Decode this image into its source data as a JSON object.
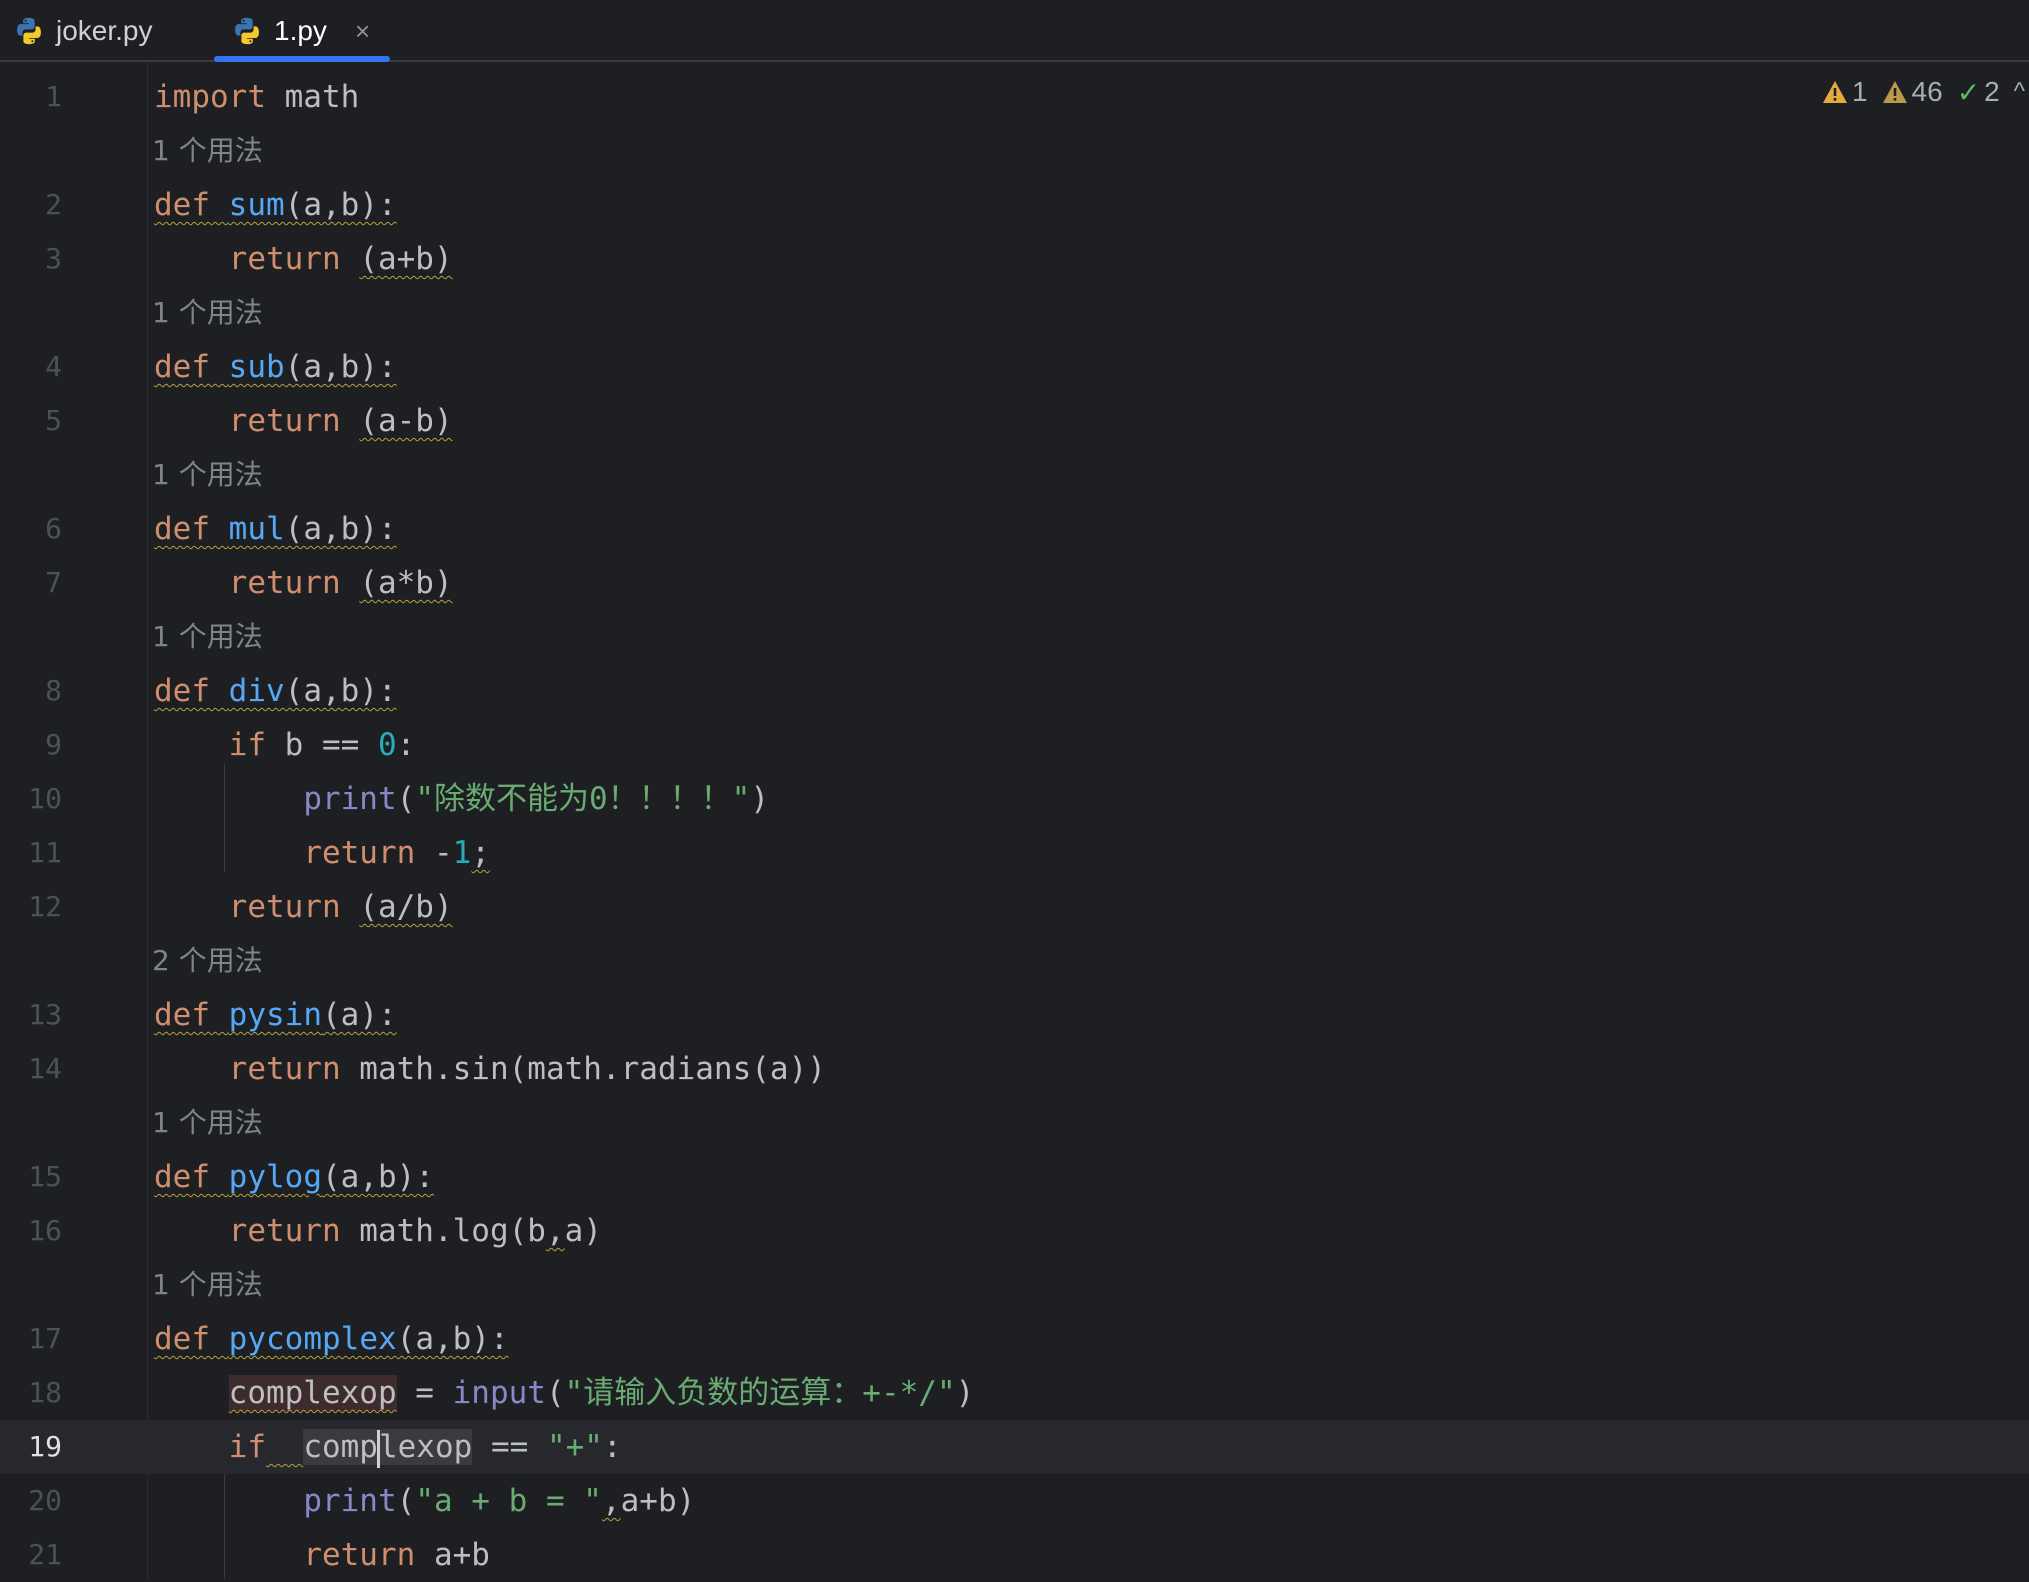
{
  "tabs": [
    {
      "label": "joker.py",
      "icon": "python-file-icon",
      "active": false
    },
    {
      "label": "1.py",
      "icon": "python-file-icon",
      "active": true,
      "close": "×"
    }
  ],
  "colors": {
    "background": "#1e1f22",
    "accent": "#3574f0",
    "keyword": "#cf8e6d",
    "function": "#56a8f5",
    "builtin": "#8888c6",
    "number": "#2aacb8",
    "string": "#6aab73"
  },
  "inspections": {
    "errors": "1",
    "warnings": "46",
    "typos": "2",
    "expand": "^"
  },
  "editor": {
    "current_line": 19,
    "hints": {
      "h1": "1 个用法",
      "h2": "1 个用法",
      "h3": "1 个用法",
      "h4": "1 个用法",
      "h5": "2 个用法",
      "h6": "1 个用法",
      "h7": "1 个用法"
    },
    "lines": {
      "l1": "import math",
      "l2": "def sum(a,b):",
      "l3": "    return (a+b)",
      "l4": "def sub(a,b):",
      "l5": "    return (a-b)",
      "l6": "def mul(a,b):",
      "l7": "    return (a*b)",
      "l8": "def div(a,b):",
      "l9": "    if b == 0:",
      "l10": "        print(\"除数不能为0！！！！\")",
      "l11": "        return -1;",
      "l12": "    return (a/b)",
      "l13": "def pysin(a):",
      "l14": "    return math.sin(math.radians(a))",
      "l15": "def pylog(a,b):",
      "l16": "    return math.log(b,a)",
      "l17": "def pycomplex(a,b):",
      "l18": "    complexop = input(\"请输入负数的运算：+-*/\")",
      "l19": "    if  complexop == \"+\":",
      "l20": "        print(\"a + b = \",a+b)",
      "l21": "        return a+b"
    }
  }
}
